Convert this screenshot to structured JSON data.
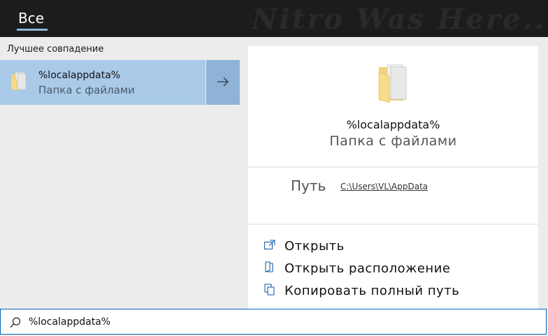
{
  "topbar": {
    "tab_all": "Все",
    "watermark": "Nitro Was Here..."
  },
  "left": {
    "section_title": "Лучшее совпадение",
    "best_match": {
      "title": "%localappdata%",
      "subtitle": "Папка с файлами",
      "icon": "folder-icon",
      "arrow_icon": "arrow-right-icon"
    }
  },
  "right": {
    "title": "%localappdata%",
    "subtitle": "Папка с файлами",
    "path_label": "Путь",
    "path_value": "C:\\Users\\VL\\AppData",
    "actions": [
      {
        "label": "Открыть",
        "icon": "open-icon"
      },
      {
        "label": "Открыть расположение",
        "icon": "open-location-icon"
      },
      {
        "label": "Копировать полный путь",
        "icon": "copy-path-icon"
      }
    ]
  },
  "search": {
    "value": "%localappdata%",
    "icon": "search-icon"
  },
  "colors": {
    "selected": "#a9cae9",
    "arrow_bg": "#8fb3d6",
    "accent_border": "#0067c0",
    "topbar": "#1c1c1c"
  }
}
